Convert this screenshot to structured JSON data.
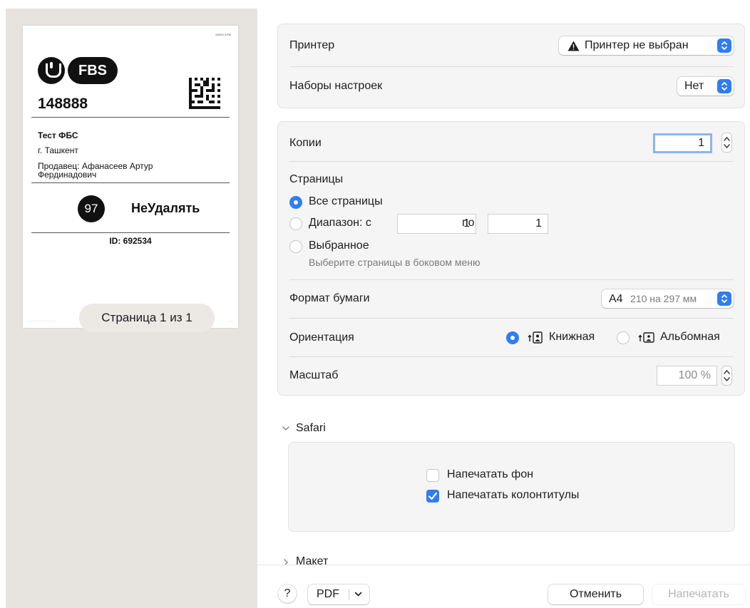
{
  "preview": {
    "tiny_header": "5/9/23 4 PM",
    "brand_badge": "FBS",
    "label_number": "148888",
    "shop_name": "Тест ФБС",
    "city": "г. Ташкент",
    "seller_line1": "Продавец: Афанасеев Артур",
    "seller_line2": "Фердинадович",
    "circle_number": "97",
    "status": "НеУдалять",
    "id_line": "ID: 692534",
    "page_indicator": "Страница 1 из 1"
  },
  "printer": {
    "label": "Принтер",
    "value": "Принтер не выбран",
    "warning_icon": "warning-triangle-icon"
  },
  "presets": {
    "label": "Наборы настроек",
    "value": "Нет"
  },
  "copies": {
    "label": "Копии",
    "value": "1"
  },
  "pages": {
    "label": "Страницы",
    "all": "Все страницы",
    "range": "Диапазон: с",
    "range_from": "1",
    "range_to_label": "по",
    "range_to": "1",
    "selection": "Выбранное",
    "selection_hint": "Выберите страницы в боковом меню"
  },
  "paper": {
    "label": "Формат бумаги",
    "value": "A4",
    "detail": "210 на 297 мм"
  },
  "orientation": {
    "label": "Ориентация",
    "portrait": "Книжная",
    "landscape": "Альбомная"
  },
  "scale": {
    "label": "Масштаб",
    "value": "100 %"
  },
  "safari": {
    "label": "Safari",
    "print_bg": "Напечатать фон",
    "print_headers": "Напечатать колонтитулы"
  },
  "layout": {
    "label": "Макет"
  },
  "footer": {
    "help": "?",
    "pdf": "PDF",
    "cancel": "Отменить",
    "print": "Напечатать"
  },
  "colors": {
    "accent": "#2f7df6",
    "pane": "#e7e3df"
  }
}
